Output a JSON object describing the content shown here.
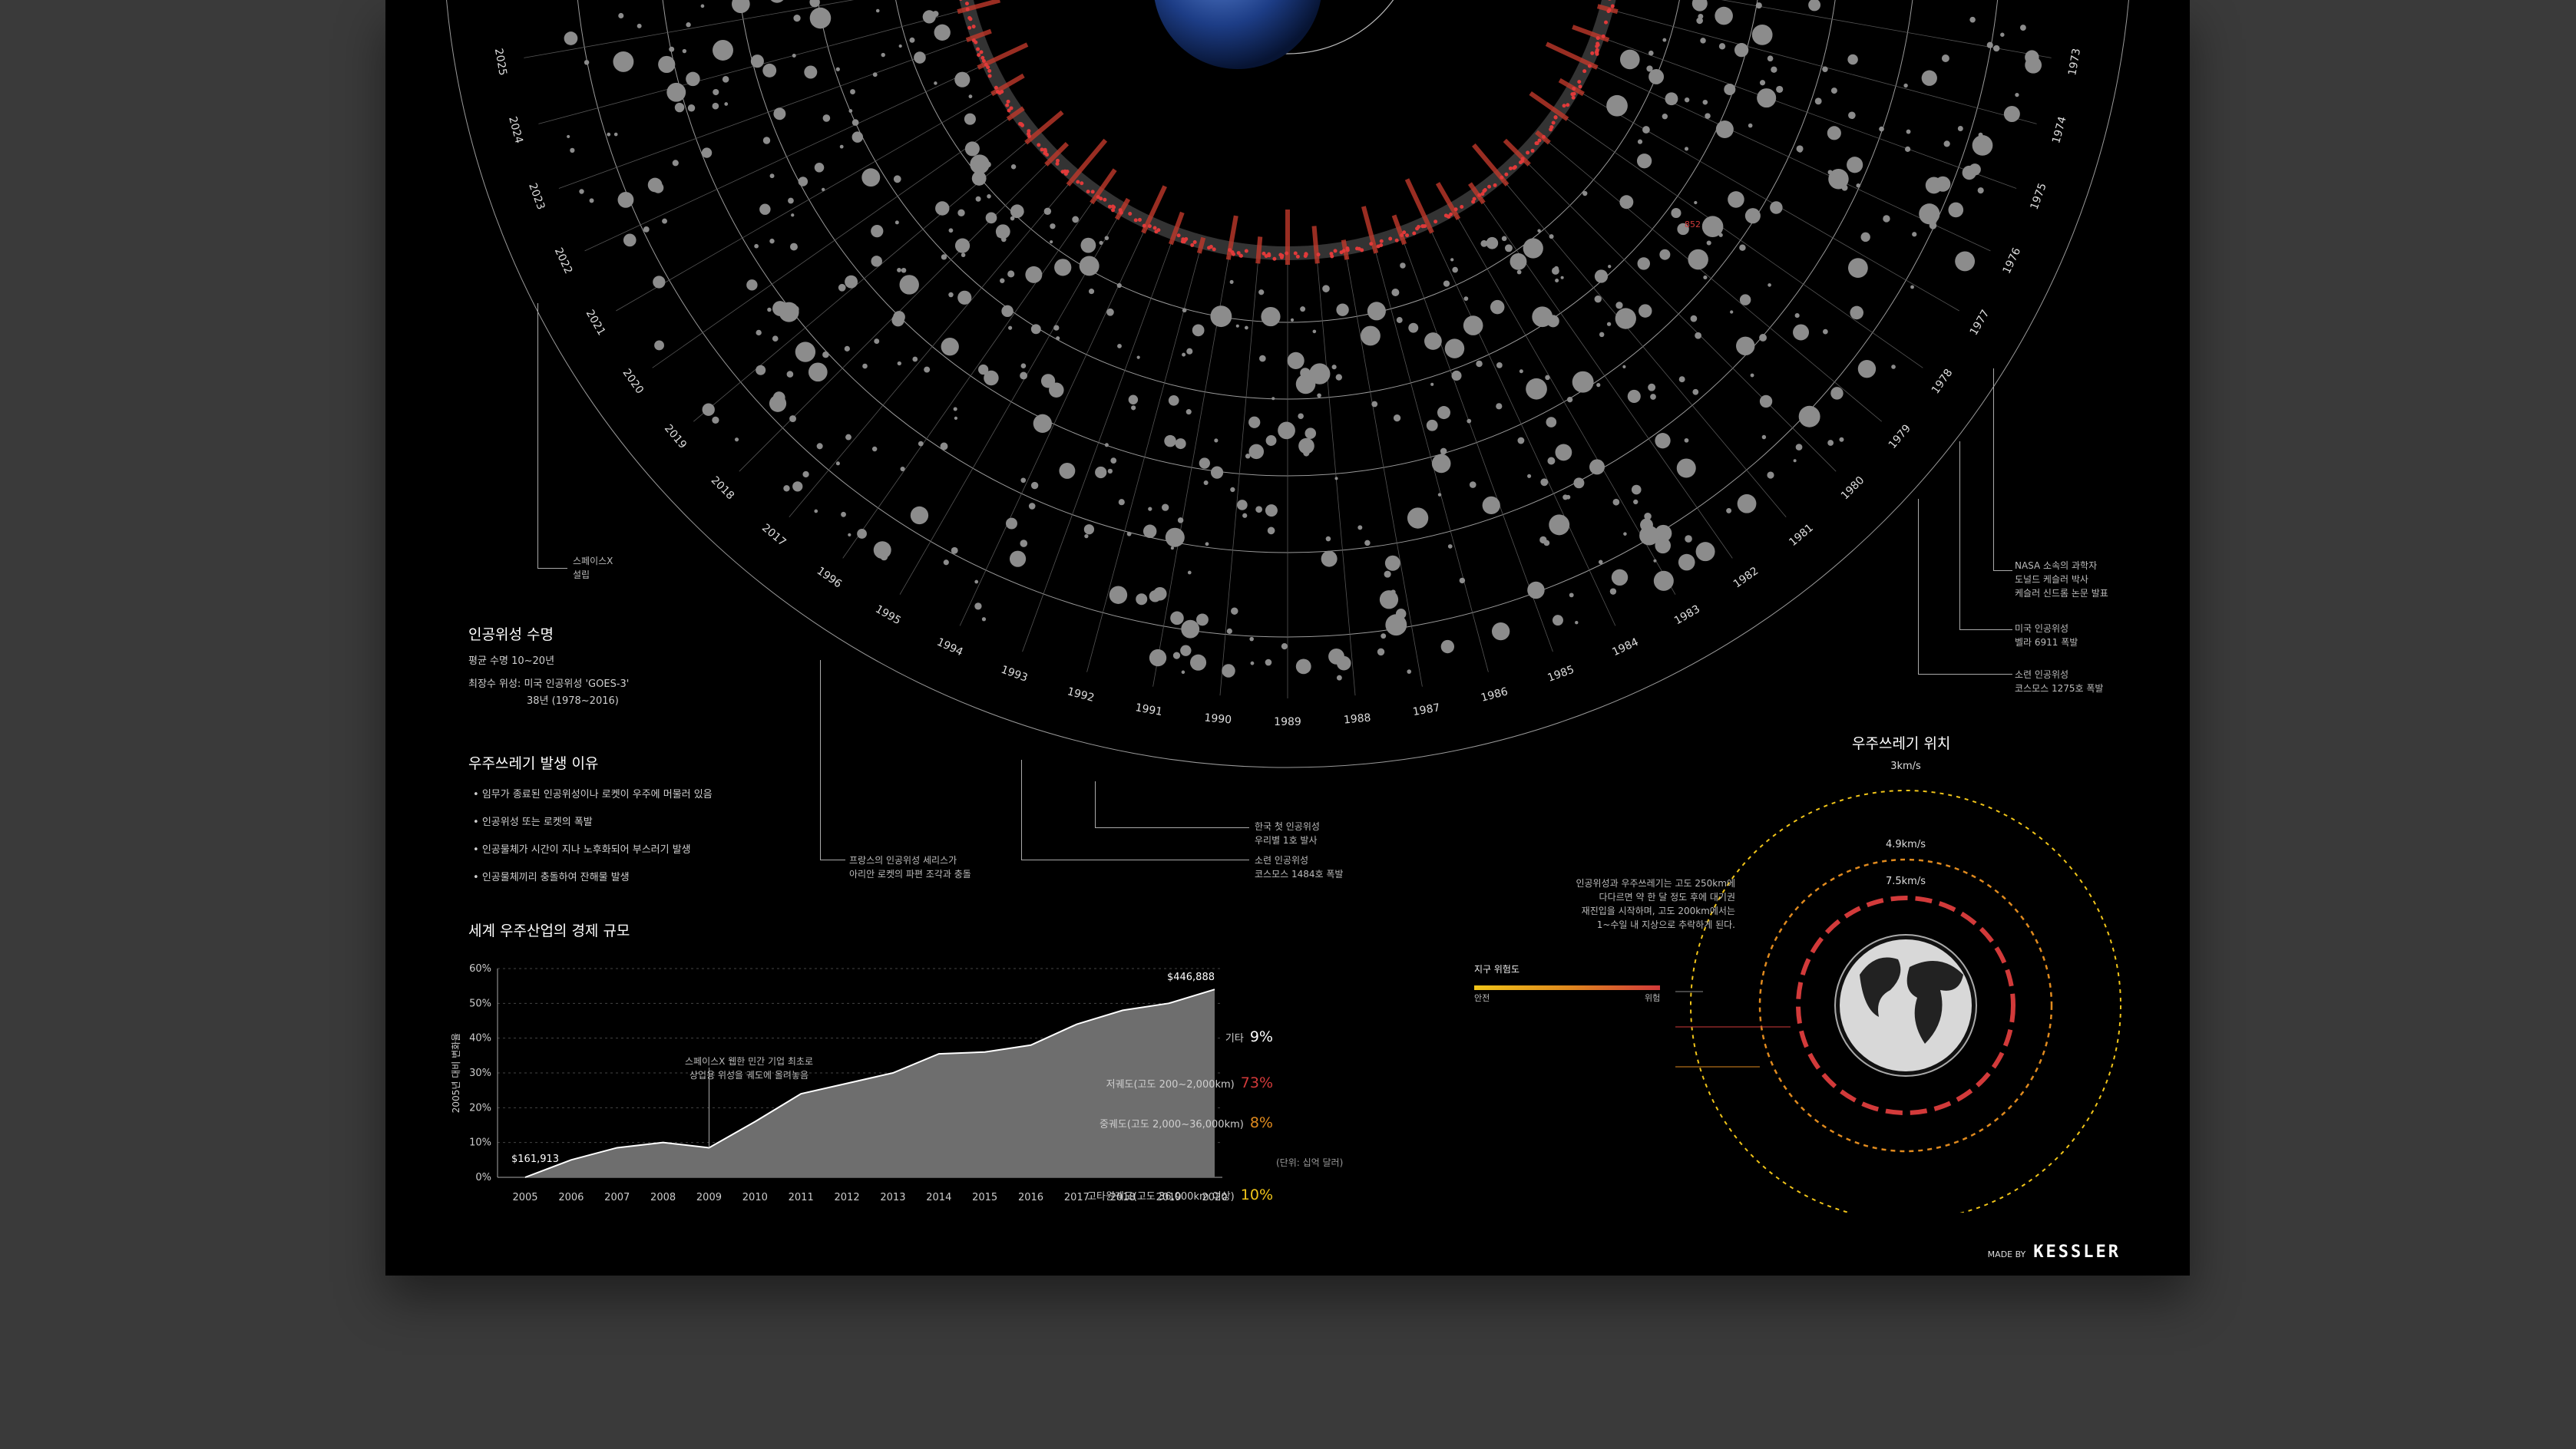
{
  "radial": {
    "years_left": [
      "2025",
      "2024",
      "2023",
      "2022",
      "2021",
      "2020",
      "2019",
      "2018",
      "2017"
    ],
    "years_bottom": [
      "1996",
      "1995",
      "1994",
      "1993",
      "1992",
      "1991",
      "1990",
      "1989",
      "1988",
      "1987",
      "1986",
      "1985",
      "1984",
      "1983",
      "1982",
      "1981"
    ],
    "years_right": [
      "1980",
      "1979",
      "1978",
      "1977",
      "1976",
      "1975",
      "1974",
      "1973"
    ],
    "red_label": "852",
    "annotations": [
      {
        "text": "스페이스X\n설립"
      },
      {
        "text": "NASA 소속의 과학자\n도널드 케슬러 박사\n케슬러 신드롬 논문 발표"
      },
      {
        "text": "미국 인공위성\n벨라 6911 폭발"
      },
      {
        "text": "소련 인공위성\n코스모스 1275호 폭발"
      },
      {
        "text": "한국 첫 인공위성\n우리별 1호 발사"
      },
      {
        "text": "소련 인공위성\n코스모스 1484호 폭발"
      },
      {
        "text": "프랑스의 인공위성 세리스가\n아리안 로켓의 파편 조각과 충돌"
      }
    ]
  },
  "lifespan": {
    "title": "인공위성 수명",
    "avg": "평균 수명 10~20년",
    "longest": "최장수 위성: 미국 인공위성 'GOES-3'",
    "longest_years": "38년 (1978~2016)"
  },
  "debris_cause": {
    "title": "우주쓰레기 발생 이유",
    "items": [
      "임무가 종료된 인공위성이나 로켓이 우주에 머물러 있음",
      "인공위성 또는 로켓의 폭발",
      "인공물체가 시간이 지나 노후화되어 부스러기 발생",
      "인공물체끼리 충돌하여 잔해물 발생"
    ]
  },
  "economy": {
    "title": "세계 우주산업의 경제 규모",
    "unit_note": "(단위: 십억 달러)",
    "annotation": "스페이스X 웹한 민간 기업 최초로\n상업용 위성을 궤도에 올려놓음"
  },
  "chart_data": {
    "type": "area",
    "ylabel": "2005년 대비 변화율",
    "yticks": [
      "0%",
      "10%",
      "20%",
      "30%",
      "40%",
      "50%",
      "60%"
    ],
    "ylim": [
      0,
      60
    ],
    "x": [
      "2005",
      "2006",
      "2007",
      "2008",
      "2009",
      "2010",
      "2011",
      "2012",
      "2013",
      "2014",
      "2015",
      "2016",
      "2017",
      "2018",
      "2019",
      "2020"
    ],
    "values": [
      0,
      5,
      8.5,
      10,
      8.5,
      16,
      24,
      27,
      30,
      35.5,
      36,
      38,
      44,
      48,
      50,
      54
    ],
    "start_label": "$161,913",
    "end_label": "$446,888",
    "area_color": "#6e6e6e",
    "line_color": "#ffffff"
  },
  "location": {
    "title": "우주쓰레기 위치",
    "speeds": [
      "3km/s",
      "4.9km/s",
      "7.5km/s"
    ],
    "description": "인공위성과 우주쓰레기는 고도 250km에\n다다르면 약 한 달 정도 후에 대기권\n재진입을 시작하며, 고도 200km에서는\n1~수일 내 지상으로 추락하게 된다.",
    "risk_title": "지구 위험도",
    "risk_low": "안전",
    "risk_high": "위험",
    "legend": [
      {
        "label": "기타",
        "pct": "9%"
      },
      {
        "label": "저궤도(고도 200~2,000km)",
        "pct": "73%"
      },
      {
        "label": "중궤도(고도 2,000~36,000km)",
        "pct": "8%"
      },
      {
        "label": "고타원궤도(고도 36,000km 이상)",
        "pct": "10%"
      }
    ],
    "colors": {
      "red": "#d23a3a",
      "orange": "#e08a1e",
      "yellow": "#f0c419"
    }
  },
  "footer": {
    "made_by": "MADE BY",
    "brand": "KESSLER"
  }
}
